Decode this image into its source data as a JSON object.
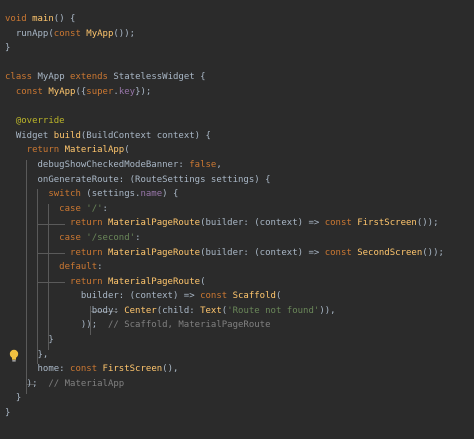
{
  "lines": [
    [
      {
        "t": "void ",
        "c": "kw"
      },
      {
        "t": "main",
        "c": "fn"
      },
      {
        "t": "() {",
        "c": "pl"
      }
    ],
    [
      {
        "t": "  runApp(",
        "c": "pl"
      },
      {
        "t": "const ",
        "c": "kw"
      },
      {
        "t": "MyApp",
        "c": "fn"
      },
      {
        "t": "());",
        "c": "pl"
      }
    ],
    [
      {
        "t": "}",
        "c": "pl"
      }
    ],
    [],
    [
      {
        "t": "class ",
        "c": "kw"
      },
      {
        "t": "MyApp ",
        "c": "pl"
      },
      {
        "t": "extends ",
        "c": "kw"
      },
      {
        "t": "StatelessWidget {",
        "c": "pl"
      }
    ],
    [
      {
        "t": "  const ",
        "c": "kw"
      },
      {
        "t": "MyApp",
        "c": "fn"
      },
      {
        "t": "({",
        "c": "pl"
      },
      {
        "t": "super",
        "c": "kw"
      },
      {
        "t": ".",
        "c": "pl"
      },
      {
        "t": "key",
        "c": "pu"
      },
      {
        "t": "});",
        "c": "pl"
      }
    ],
    [],
    [
      {
        "t": "  @override",
        "c": "ann"
      }
    ],
    [
      {
        "t": "  Widget ",
        "c": "pl"
      },
      {
        "t": "build",
        "c": "fn"
      },
      {
        "t": "(BuildContext context) {",
        "c": "pl"
      }
    ],
    [
      {
        "t": "    return ",
        "c": "kw"
      },
      {
        "t": "MaterialApp",
        "c": "fn"
      },
      {
        "t": "(",
        "c": "pl"
      }
    ],
    [
      {
        "t": "      debugShowCheckedModeBanner: ",
        "c": "pl"
      },
      {
        "t": "false",
        "c": "kw"
      },
      {
        "t": ",",
        "c": "pl"
      }
    ],
    [
      {
        "t": "      onGenerateRoute: (RouteSettings settings) {",
        "c": "pl"
      }
    ],
    [
      {
        "t": "        switch ",
        "c": "kw"
      },
      {
        "t": "(settings.",
        "c": "pl"
      },
      {
        "t": "name",
        "c": "pu"
      },
      {
        "t": ") {",
        "c": "pl"
      }
    ],
    [
      {
        "t": "          case ",
        "c": "kw"
      },
      {
        "t": "'/'",
        "c": "str"
      },
      {
        "t": ":",
        "c": "pl"
      }
    ],
    [
      {
        "t": "            return ",
        "c": "kw"
      },
      {
        "t": "MaterialPageRoute",
        "c": "fn"
      },
      {
        "t": "(builder: (context) => ",
        "c": "pl"
      },
      {
        "t": "const ",
        "c": "kw"
      },
      {
        "t": "FirstScreen",
        "c": "fn"
      },
      {
        "t": "());",
        "c": "pl"
      }
    ],
    [
      {
        "t": "          case ",
        "c": "kw"
      },
      {
        "t": "'/second'",
        "c": "str"
      },
      {
        "t": ":",
        "c": "pl"
      }
    ],
    [
      {
        "t": "            return ",
        "c": "kw"
      },
      {
        "t": "MaterialPageRoute",
        "c": "fn"
      },
      {
        "t": "(builder: (context) => ",
        "c": "pl"
      },
      {
        "t": "const ",
        "c": "kw"
      },
      {
        "t": "SecondScreen",
        "c": "fn"
      },
      {
        "t": "());",
        "c": "pl"
      }
    ],
    [
      {
        "t": "          default",
        "c": "kw"
      },
      {
        "t": ":",
        "c": "pl"
      }
    ],
    [
      {
        "t": "            return ",
        "c": "kw"
      },
      {
        "t": "MaterialPageRoute",
        "c": "fn"
      },
      {
        "t": "(",
        "c": "pl"
      }
    ],
    [
      {
        "t": "              builder: (context) => ",
        "c": "pl"
      },
      {
        "t": "const ",
        "c": "kw"
      },
      {
        "t": "Scaffold",
        "c": "fn"
      },
      {
        "t": "(",
        "c": "pl"
      }
    ],
    [
      {
        "t": "                body: ",
        "c": "pl"
      },
      {
        "t": "Center",
        "c": "fn"
      },
      {
        "t": "(child: ",
        "c": "pl"
      },
      {
        "t": "Text",
        "c": "fn"
      },
      {
        "t": "(",
        "c": "pl"
      },
      {
        "t": "'Route not found'",
        "c": "str"
      },
      {
        "t": ")),",
        "c": "pl"
      }
    ],
    [
      {
        "t": "              ));  ",
        "c": "pl"
      },
      {
        "t": "// Scaffold, MaterialPageRoute",
        "c": "cmt"
      }
    ],
    [
      {
        "t": "        }",
        "c": "pl"
      }
    ],
    [
      {
        "t": "      },",
        "c": "pl"
      }
    ],
    [
      {
        "t": "      home: ",
        "c": "pl"
      },
      {
        "t": "const ",
        "c": "kw"
      },
      {
        "t": "FirstScreen",
        "c": "fn"
      },
      {
        "t": "(),",
        "c": "pl"
      }
    ],
    [
      {
        "t": "    );  ",
        "c": "pl"
      },
      {
        "t": "// MaterialApp",
        "c": "cmt"
      }
    ],
    [
      {
        "t": "  }",
        "c": "pl"
      }
    ],
    [
      {
        "t": "}",
        "c": "pl"
      }
    ]
  ],
  "colors": {
    "background": "#2b2b2b",
    "keyword": "#cc7832",
    "function": "#ffc66d",
    "string": "#6a8759",
    "annotation": "#bbb529",
    "comment": "#808080",
    "plain": "#a9b7c6",
    "property": "#9876aa",
    "bulb": "#f0c040"
  },
  "icons": {
    "gutter_hint": "lightbulb-icon"
  }
}
